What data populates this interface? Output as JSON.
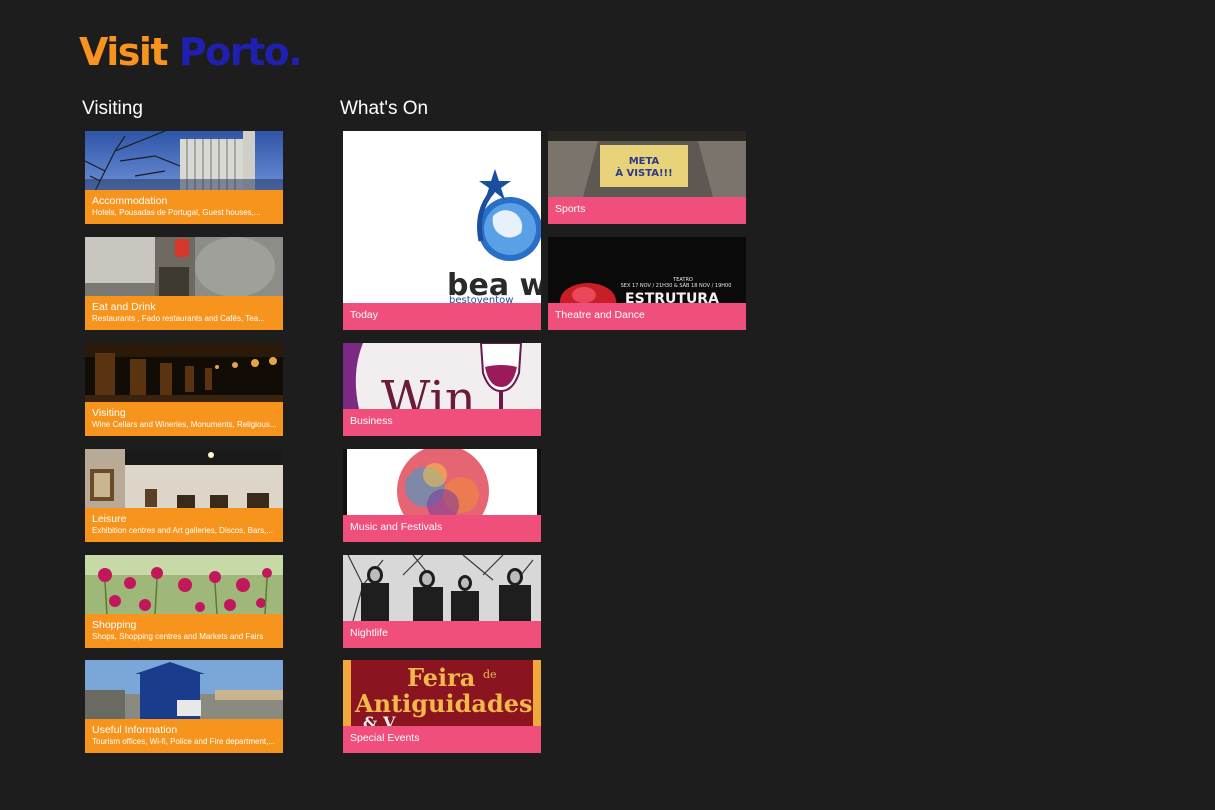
{
  "app": {
    "logo_word1": "Visit",
    "logo_word2": "Porto."
  },
  "colors": {
    "background": "#1d1d1d",
    "visiting_accent": "#f7941d",
    "whats_on_accent": "#ef4f7a",
    "logo_orange": "#f7931e",
    "logo_blue": "#1f1fb0"
  },
  "visiting": {
    "title": "Visiting",
    "items": [
      {
        "label": "Accommodation",
        "subtitle": "Hotels, Pousadas de Portugal, Guest houses,..."
      },
      {
        "label": "Eat and Drink",
        "subtitle": "Restaurants , Fado restaurants and Cafés, Tea..."
      },
      {
        "label": "Visiting",
        "subtitle": "Wine Cellars and Wineries, Monuments, Religious..."
      },
      {
        "label": "Leisure",
        "subtitle": "Exhibition centres and Art galleries, Discos, Bars,..."
      },
      {
        "label": "Shopping",
        "subtitle": "Shops, Shopping centres and Markets and Fairs"
      },
      {
        "label": "Useful Information",
        "subtitle": "Tourism offices, Wi-fi, Police and Fire department,..."
      }
    ]
  },
  "whats_on": {
    "title": "What's On",
    "items": [
      {
        "label": "Today"
      },
      {
        "label": "Sports"
      },
      {
        "label": "Theatre and Dance"
      },
      {
        "label": "Business"
      },
      {
        "label": "Music and Festivals"
      },
      {
        "label": "Nightlife"
      },
      {
        "label": "Special Events"
      }
    ]
  },
  "image_text": {
    "today": [
      "bea wo",
      "bestoventow"
    ],
    "sports": [
      "META",
      "À VISTA!!!"
    ],
    "theatre": [
      "TEATRO",
      "SEX 17 NOV / 21H30 & SÁB 18 NOV / 19H00",
      "ESTRUTURA"
    ],
    "business": "Win",
    "special": [
      "Feira",
      "de",
      "Antiguidades",
      "& V"
    ]
  }
}
